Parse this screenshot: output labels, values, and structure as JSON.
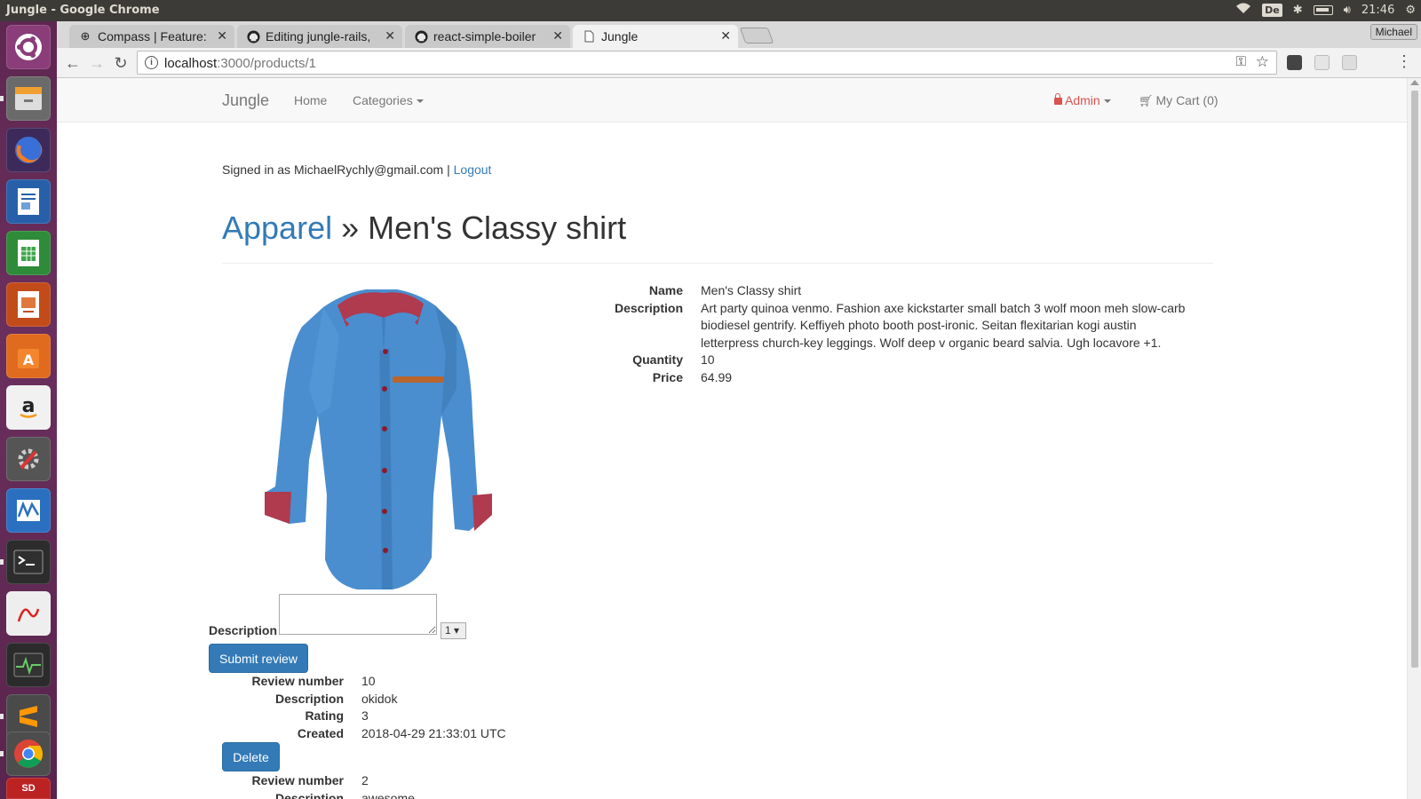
{
  "os": {
    "window_title": "Jungle - Google Chrome",
    "keyboard_layout": "De",
    "clock": "21:46"
  },
  "browser": {
    "tabs": [
      {
        "title": "Compass | Feature:",
        "icon": "compass-icon"
      },
      {
        "title": "Editing jungle-rails,",
        "icon": "github-icon"
      },
      {
        "title": "react-simple-boiler",
        "icon": "github-icon"
      },
      {
        "title": "Jungle",
        "icon": "page-icon"
      }
    ],
    "profile": "Michael",
    "url_host": "localhost",
    "url_path": ":3000/products/1"
  },
  "nav": {
    "brand": "Jungle",
    "home": "Home",
    "categories": "Categories",
    "admin": "Admin",
    "cart": "My Cart (0)"
  },
  "session": {
    "signed_in_as": "Signed in as MichaelRychly@gmail.com |",
    "logout": "Logout"
  },
  "product": {
    "category": "Apparel",
    "separator": "»",
    "name": "Men's Classy shirt",
    "labels": {
      "name": "Name",
      "description": "Description",
      "quantity": "Quantity",
      "price": "Price"
    },
    "description": "Art party quinoa venmo. Fashion axe kickstarter small batch 3 wolf moon meh slow-carb biodiesel gentrify. Keffiyeh photo booth post-ironic. Seitan flexitarian kogi austin letterpress church-key leggings. Wolf deep v organic beard salvia. Ugh locavore +1.",
    "quantity": "10",
    "price": "64.99",
    "image_colors": {
      "shirt": "#4a8ecf",
      "collar": "#b03a4e",
      "pocket": "#b9652b"
    }
  },
  "review_form": {
    "label": "Description",
    "description_value": "",
    "rating_value": "1 ▾",
    "submit": "Submit review"
  },
  "reviews_labels": {
    "number": "Review number",
    "description": "Description",
    "rating": "Rating",
    "created": "Created"
  },
  "reviews": [
    {
      "number": "10",
      "description": "okidok",
      "rating": "3",
      "created": "2018-04-29 21:33:01 UTC",
      "delete": "Delete"
    },
    {
      "number": "2",
      "description": "awesome"
    }
  ]
}
